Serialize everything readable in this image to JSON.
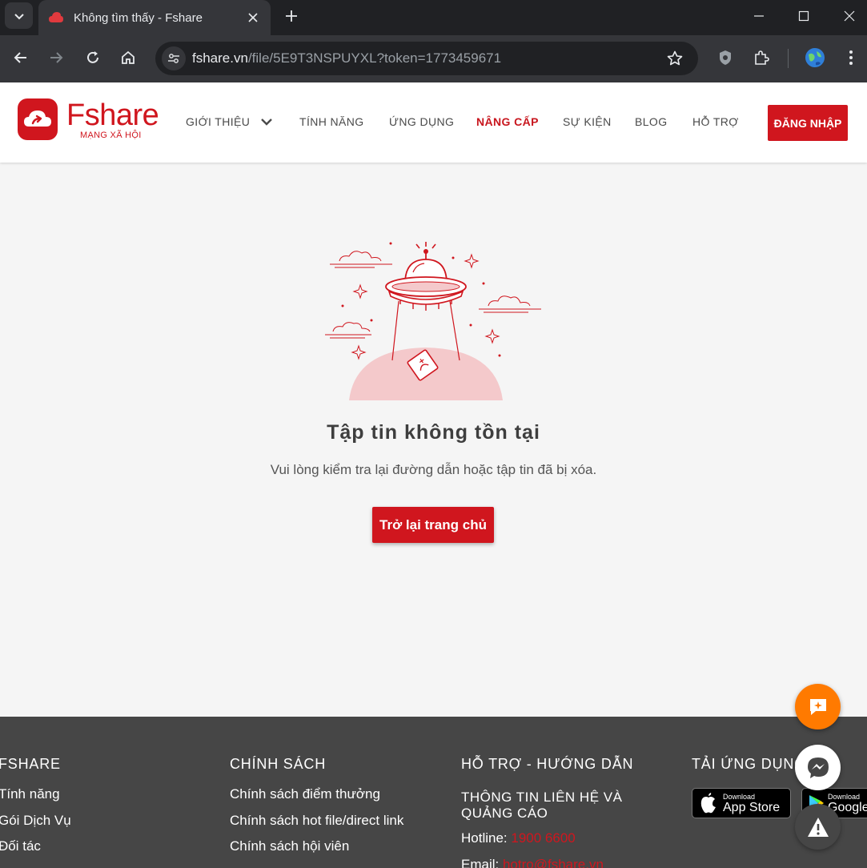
{
  "browser": {
    "tab_title": "Không tìm thấy - Fshare",
    "url_host": "fshare.vn",
    "url_path": "/file/5E9T3NSPUYXL?token=1773459671"
  },
  "header": {
    "logo_word": "Fshare",
    "logo_sub": "MẠNG XÃ HỘI",
    "nav": {
      "gioi_thieu": "GIỚI THIỆU",
      "tinh_nang": "TÍNH NĂNG",
      "ung_dung": "ỨNG DỤNG",
      "nang_cap": "NÂNG CẤP",
      "su_kien": "SỰ KIỆN",
      "blog": "BLOG",
      "ho_tro": "HỖ TRỢ"
    },
    "login_label": "ĐĂNG NHẬP"
  },
  "main": {
    "title": "Tập tin không tồn tại",
    "description": "Vui lòng kiểm tra lại đường dẫn hoặc tập tin đã bị xóa.",
    "home_button": "Trở lại trang chủ"
  },
  "footer": {
    "col1": {
      "heading": "FSHARE",
      "links": [
        "Tính năng",
        "Gói Dịch Vụ",
        "Đối tác"
      ]
    },
    "col2": {
      "heading": "CHÍNH SÁCH",
      "links": [
        "Chính sách điểm thưởng",
        "Chính sách hot file/direct link",
        "Chính sách hội viên"
      ]
    },
    "col3": {
      "heading": "HỖ TRỢ - HƯỚNG DẪN",
      "contact_heading": "THÔNG TIN LIÊN HỆ VÀ QUẢNG CÁO",
      "hotline_label": "Hotline:",
      "hotline_value": "1900 6600",
      "email_label": "Email:",
      "email_value": "hotro@fshare.vn"
    },
    "col4": {
      "heading": "TẢI ỨNG DỤNG",
      "appstore_top": "Download",
      "appstore_name": "App Store",
      "play_top": "Download",
      "play_name": "Google"
    }
  },
  "colors": {
    "brand_red": "#d0161e",
    "footer_bg": "#464646",
    "fab_orange": "#ff7a00"
  }
}
